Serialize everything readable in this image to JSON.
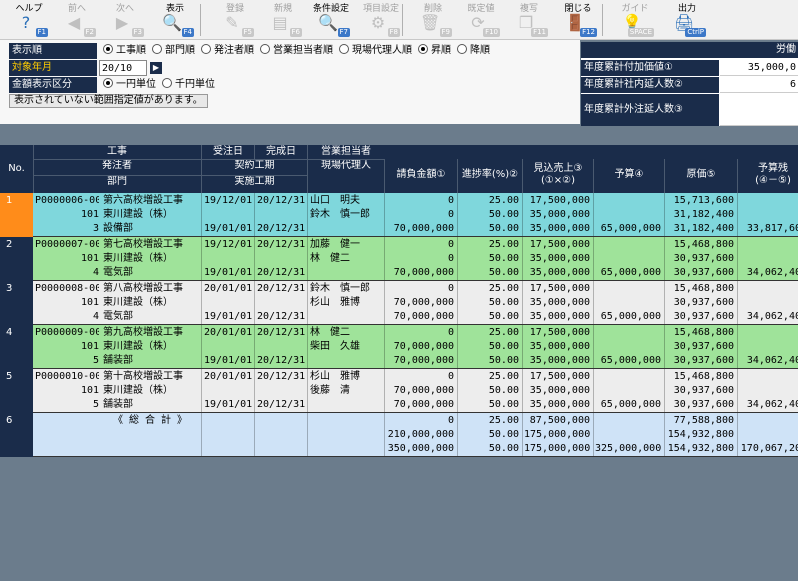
{
  "toolbar": {
    "buttons": [
      {
        "label": "ヘルプ",
        "key": "F1",
        "icon": "?"
      },
      {
        "label": "前へ",
        "key": "F2",
        "icon": "◀"
      },
      {
        "label": "次へ",
        "key": "F3",
        "icon": "▶"
      },
      {
        "label": "表示",
        "key": "F4",
        "icon": "🔍"
      },
      {
        "label": "登録",
        "key": "F5",
        "icon": "✎"
      },
      {
        "label": "新規",
        "key": "F6",
        "icon": "▤"
      },
      {
        "label": "条件設定",
        "key": "F7",
        "icon": "🔍"
      },
      {
        "label": "項目設定",
        "key": "F8",
        "icon": "⚙"
      },
      {
        "label": "削除",
        "key": "F9",
        "icon": "🗑"
      },
      {
        "label": "既定値",
        "key": "F10",
        "icon": "⟳"
      },
      {
        "label": "複写",
        "key": "F11",
        "icon": "❐"
      },
      {
        "label": "閉じる",
        "key": "F12",
        "icon": "🚪"
      },
      {
        "label": "ガイド",
        "key": "SPACE",
        "icon": "💡"
      },
      {
        "label": "出力",
        "key": "CtrlP",
        "icon": "🖨"
      }
    ]
  },
  "filters": {
    "sort_label": "表示順",
    "sort_options": [
      "工事順",
      "部門順",
      "発注者順",
      "営業担当者順",
      "現場代理人順"
    ],
    "order_options": [
      "昇順",
      "降順"
    ],
    "ym_label": "対象年月",
    "ym_value": "20/10",
    "ym_btn": "▶",
    "amount_label": "金額表示区分",
    "amount_options": [
      "一円単位",
      "千円単位"
    ],
    "warning": "表示されていない範囲指定値があります。"
  },
  "stats": {
    "header": "労働",
    "items": [
      {
        "label": "年度累計付加価値①",
        "value": "35,000,0"
      },
      {
        "label": "年度累計社内延人数②",
        "value": "6"
      },
      {
        "label": "年度累計外注延人数③",
        "value": ""
      }
    ]
  },
  "table": {
    "headers": {
      "no": "No.",
      "koji": "工事",
      "hacchu": "発注者",
      "bumon": "部門",
      "jyuchu": "受注日",
      "kansei": "完成日",
      "keiyaku": "契約工期",
      "jisshi": "実施工期",
      "eigyo": "営業担当者",
      "genba": "現場代理人",
      "ukeoi": "請負金額①",
      "shinchoku": "進捗率(%)②",
      "mikomi": "見込売上③",
      "mikomi2": "(①×②)",
      "yosan": "予算④",
      "genka": "原価⑤",
      "yosanzan": "予算残",
      "yosanzan2": "(④－⑤)"
    },
    "rows": [
      {
        "no": "1",
        "color": "#7fd7dc",
        "selected": true,
        "lines": [
          {
            "code": "P0000006-00",
            "name": "第六高校増設工事",
            "d1": "19/12/01",
            "d2": "20/12/31",
            "person": "山口　明夫",
            "amt": "0",
            "pct": "25.00",
            "mik": "17,500,000",
            "yos": "",
            "gen": "15,713,600",
            "zan": ""
          },
          {
            "code": "101",
            "name": "東川建設（株）",
            "d1": "",
            "d2": "",
            "person": "鈴木　慎一郎",
            "amt": "0",
            "pct": "50.00",
            "mik": "35,000,000",
            "yos": "",
            "gen": "31,182,400",
            "zan": ""
          },
          {
            "code": "3",
            "name": "設備部",
            "d1": "19/01/01",
            "d2": "20/12/31",
            "person": "",
            "amt": "70,000,000",
            "pct": "50.00",
            "mik": "35,000,000",
            "yos": "65,000,000",
            "gen": "31,182,400",
            "zan": "33,817,60"
          }
        ]
      },
      {
        "no": "2",
        "color": "#9fe39a",
        "selected": false,
        "lines": [
          {
            "code": "P0000007-00",
            "name": "第七高校増設工事",
            "d1": "19/12/01",
            "d2": "20/12/31",
            "person": "加藤　健一",
            "amt": "0",
            "pct": "25.00",
            "mik": "17,500,000",
            "yos": "",
            "gen": "15,468,800",
            "zan": ""
          },
          {
            "code": "101",
            "name": "東川建設（株）",
            "d1": "",
            "d2": "",
            "person": "林　健二",
            "amt": "0",
            "pct": "50.00",
            "mik": "35,000,000",
            "yos": "",
            "gen": "30,937,600",
            "zan": ""
          },
          {
            "code": "4",
            "name": "電気部",
            "d1": "19/01/01",
            "d2": "20/12/31",
            "person": "",
            "amt": "70,000,000",
            "pct": "50.00",
            "mik": "35,000,000",
            "yos": "65,000,000",
            "gen": "30,937,600",
            "zan": "34,062,40"
          }
        ]
      },
      {
        "no": "3",
        "color": "#ededed",
        "selected": false,
        "lines": [
          {
            "code": "P0000008-00",
            "name": "第八高校増設工事",
            "d1": "20/01/01",
            "d2": "20/12/31",
            "person": "鈴木　慎一郎",
            "amt": "0",
            "pct": "25.00",
            "mik": "17,500,000",
            "yos": "",
            "gen": "15,468,800",
            "zan": ""
          },
          {
            "code": "101",
            "name": "東川建設（株）",
            "d1": "",
            "d2": "",
            "person": "杉山　雅博",
            "amt": "70,000,000",
            "pct": "50.00",
            "mik": "35,000,000",
            "yos": "",
            "gen": "30,937,600",
            "zan": ""
          },
          {
            "code": "4",
            "name": "電気部",
            "d1": "19/01/01",
            "d2": "20/12/31",
            "person": "",
            "amt": "70,000,000",
            "pct": "50.00",
            "mik": "35,000,000",
            "yos": "65,000,000",
            "gen": "30,937,600",
            "zan": "34,062,40"
          }
        ]
      },
      {
        "no": "4",
        "color": "#9fe39a",
        "selected": false,
        "lines": [
          {
            "code": "P0000009-00",
            "name": "第九高校増設工事",
            "d1": "20/01/01",
            "d2": "20/12/31",
            "person": "林　健二",
            "amt": "0",
            "pct": "25.00",
            "mik": "17,500,000",
            "yos": "",
            "gen": "15,468,800",
            "zan": ""
          },
          {
            "code": "101",
            "name": "東川建設（株）",
            "d1": "",
            "d2": "",
            "person": "柴田　久雄",
            "amt": "70,000,000",
            "pct": "50.00",
            "mik": "35,000,000",
            "yos": "",
            "gen": "30,937,600",
            "zan": ""
          },
          {
            "code": "5",
            "name": "舗装部",
            "d1": "19/01/01",
            "d2": "20/12/31",
            "person": "",
            "amt": "70,000,000",
            "pct": "50.00",
            "mik": "35,000,000",
            "yos": "65,000,000",
            "gen": "30,937,600",
            "zan": "34,062,40"
          }
        ]
      },
      {
        "no": "5",
        "color": "#ededed",
        "selected": false,
        "lines": [
          {
            "code": "P0000010-00",
            "name": "第十高校増設工事",
            "d1": "20/01/01",
            "d2": "20/12/31",
            "person": "杉山　雅博",
            "amt": "0",
            "pct": "25.00",
            "mik": "17,500,000",
            "yos": "",
            "gen": "15,468,800",
            "zan": ""
          },
          {
            "code": "101",
            "name": "東川建設（株）",
            "d1": "",
            "d2": "",
            "person": "後藤　清",
            "amt": "70,000,000",
            "pct": "50.00",
            "mik": "35,000,000",
            "yos": "",
            "gen": "30,937,600",
            "zan": ""
          },
          {
            "code": "5",
            "name": "舗装部",
            "d1": "19/01/01",
            "d2": "20/12/31",
            "person": "",
            "amt": "70,000,000",
            "pct": "50.00",
            "mik": "35,000,000",
            "yos": "65,000,000",
            "gen": "30,937,600",
            "zan": "34,062,40"
          }
        ]
      },
      {
        "no": "6",
        "color": "#cfe3f7",
        "selected": false,
        "lines": [
          {
            "code": "",
            "name": "《 総 合 計 》",
            "d1": "",
            "d2": "",
            "person": "",
            "amt": "0",
            "pct": "25.00",
            "mik": "87,500,000",
            "yos": "",
            "gen": "77,588,800",
            "zan": ""
          },
          {
            "code": "",
            "name": "",
            "d1": "",
            "d2": "",
            "person": "",
            "amt": "210,000,000",
            "pct": "50.00",
            "mik": "175,000,000",
            "yos": "",
            "gen": "154,932,800",
            "zan": ""
          },
          {
            "code": "",
            "name": "",
            "d1": "",
            "d2": "",
            "person": "",
            "amt": "350,000,000",
            "pct": "50.00",
            "mik": "175,000,000",
            "yos": "325,000,000",
            "gen": "154,932,800",
            "zan": "170,067,20"
          }
        ]
      }
    ]
  }
}
